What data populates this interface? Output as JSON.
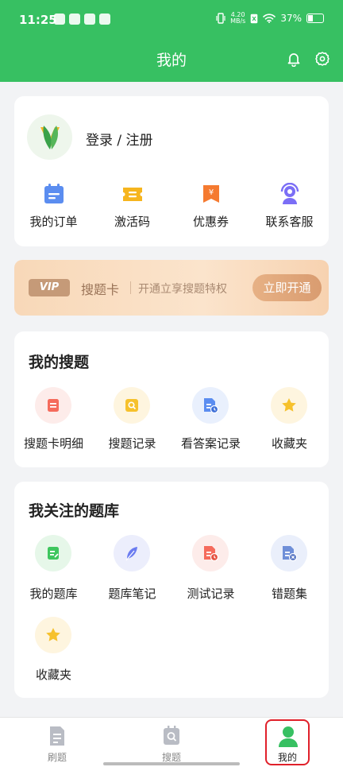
{
  "status_bar": {
    "time": "11:25",
    "speed_value": "4.20",
    "speed_unit": "MB/s",
    "battery": "37%"
  },
  "header": {
    "title": "我的"
  },
  "profile": {
    "login_label": "登录 / 注册"
  },
  "quick_actions": [
    {
      "label": "我的订单",
      "icon": "calendar-icon",
      "color": "#5b8df0"
    },
    {
      "label": "激活码",
      "icon": "ticket-icon",
      "color": "#f6b51e"
    },
    {
      "label": "优惠券",
      "icon": "coupon-icon",
      "color": "#f57a30"
    },
    {
      "label": "联系客服",
      "icon": "headset-icon",
      "color": "#7b6ef6"
    }
  ],
  "vip": {
    "badge": "VIP",
    "name": "搜题卡",
    "description": "开通立享搜题特权",
    "button": "立即开通"
  },
  "my_search": {
    "title": "我的搜题",
    "items": [
      {
        "label": "搜题卡明细",
        "icon": "card-detail-icon",
        "color": "#f56b5c"
      },
      {
        "label": "搜题记录",
        "icon": "search-record-icon",
        "color": "#f6c12c"
      },
      {
        "label": "看答案记录",
        "icon": "answer-record-icon",
        "color": "#5b8df0"
      },
      {
        "label": "收藏夹",
        "icon": "star-icon",
        "color": "#f6c12c"
      }
    ]
  },
  "my_libraries": {
    "title": "我关注的题库",
    "items": [
      {
        "label": "我的题库",
        "icon": "library-icon",
        "color": "#3ec65e"
      },
      {
        "label": "题库笔记",
        "icon": "feather-icon",
        "color": "#6b7cf0"
      },
      {
        "label": "测试记录",
        "icon": "test-record-icon",
        "color": "#f56b5c"
      },
      {
        "label": "错题集",
        "icon": "wrong-set-icon",
        "color": "#6f8fd8"
      },
      {
        "label": "收藏夹",
        "icon": "star-icon",
        "color": "#f6c12c"
      }
    ]
  },
  "bottom_nav": [
    {
      "label": "刷题",
      "icon": "practice-icon"
    },
    {
      "label": "搜题",
      "icon": "search-tab-icon"
    },
    {
      "label": "我的",
      "icon": "profile-icon",
      "active": true
    }
  ],
  "colors": {
    "primary": "#37c062",
    "background": "#f2f3f5",
    "highlight": "#e0202a"
  }
}
